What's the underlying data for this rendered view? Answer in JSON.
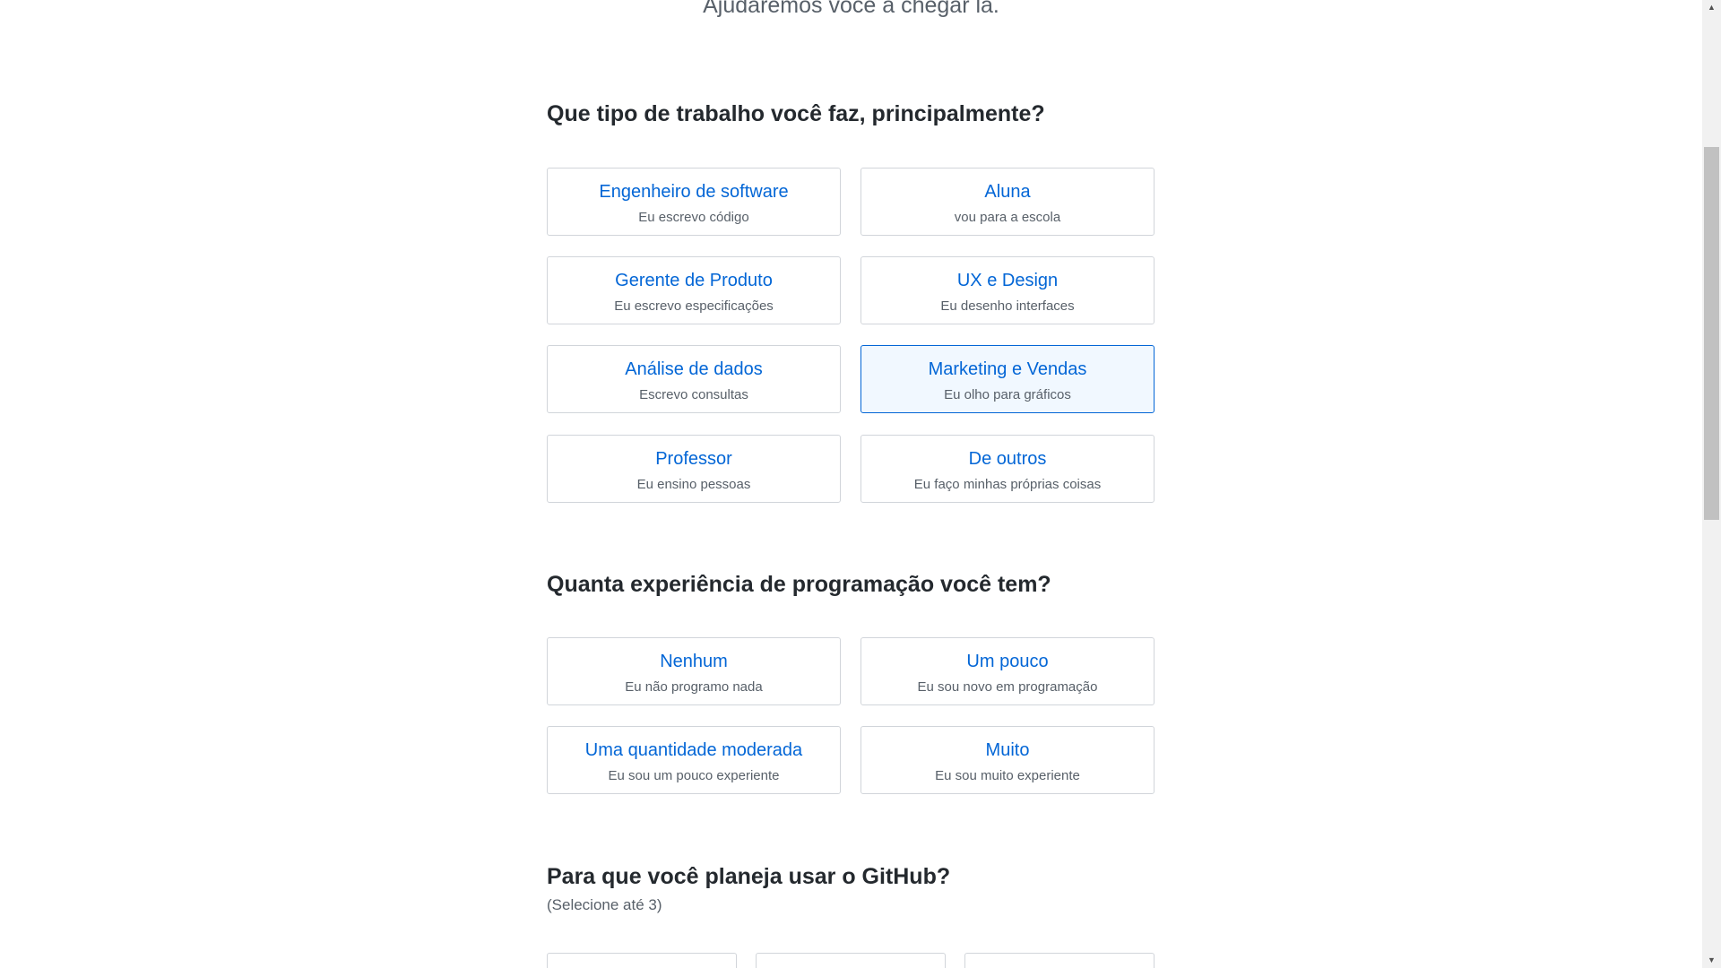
{
  "header": {
    "subtitle": "Ajudaremos você a chegar lá."
  },
  "work_section": {
    "title": "Que tipo de trabalho você faz, principalmente?",
    "options": [
      {
        "title": "Engenheiro de software",
        "subtitle": "Eu escrevo código",
        "selected": false
      },
      {
        "title": "Aluna",
        "subtitle": "vou para a escola",
        "selected": false
      },
      {
        "title": "Gerente de Produto",
        "subtitle": "Eu escrevo especificações",
        "selected": false
      },
      {
        "title": "UX e Design",
        "subtitle": "Eu desenho interfaces",
        "selected": false
      },
      {
        "title": "Análise de dados",
        "subtitle": "Escrevo consultas",
        "selected": false
      },
      {
        "title": "Marketing e Vendas",
        "subtitle": "Eu olho para gráficos",
        "selected": true
      },
      {
        "title": "Professor",
        "subtitle": "Eu ensino pessoas",
        "selected": false
      },
      {
        "title": "De outros",
        "subtitle": "Eu faço minhas próprias coisas",
        "selected": false
      }
    ]
  },
  "experience_section": {
    "title": "Quanta experiência de programação você tem?",
    "options": [
      {
        "title": "Nenhum",
        "subtitle": "Eu não programo nada",
        "selected": false
      },
      {
        "title": "Um pouco",
        "subtitle": "Eu sou novo em programação",
        "selected": false
      },
      {
        "title": "Uma quantidade moderada",
        "subtitle": "Eu sou um pouco experiente",
        "selected": false
      },
      {
        "title": "Muito",
        "subtitle": "Eu sou muito experiente",
        "selected": false
      }
    ]
  },
  "usage_section": {
    "title": "Para que você planeja usar o GitHub?",
    "hint": "(Selecione até 3)"
  },
  "colors": {
    "accent": "#0366d6",
    "selected_bg": "#f1f8ff",
    "border": "#d1d5da",
    "text": "#24292e",
    "muted": "#586069"
  },
  "scrollbar": {
    "up_icon": "triangle-up",
    "down_icon": "triangle-down"
  }
}
